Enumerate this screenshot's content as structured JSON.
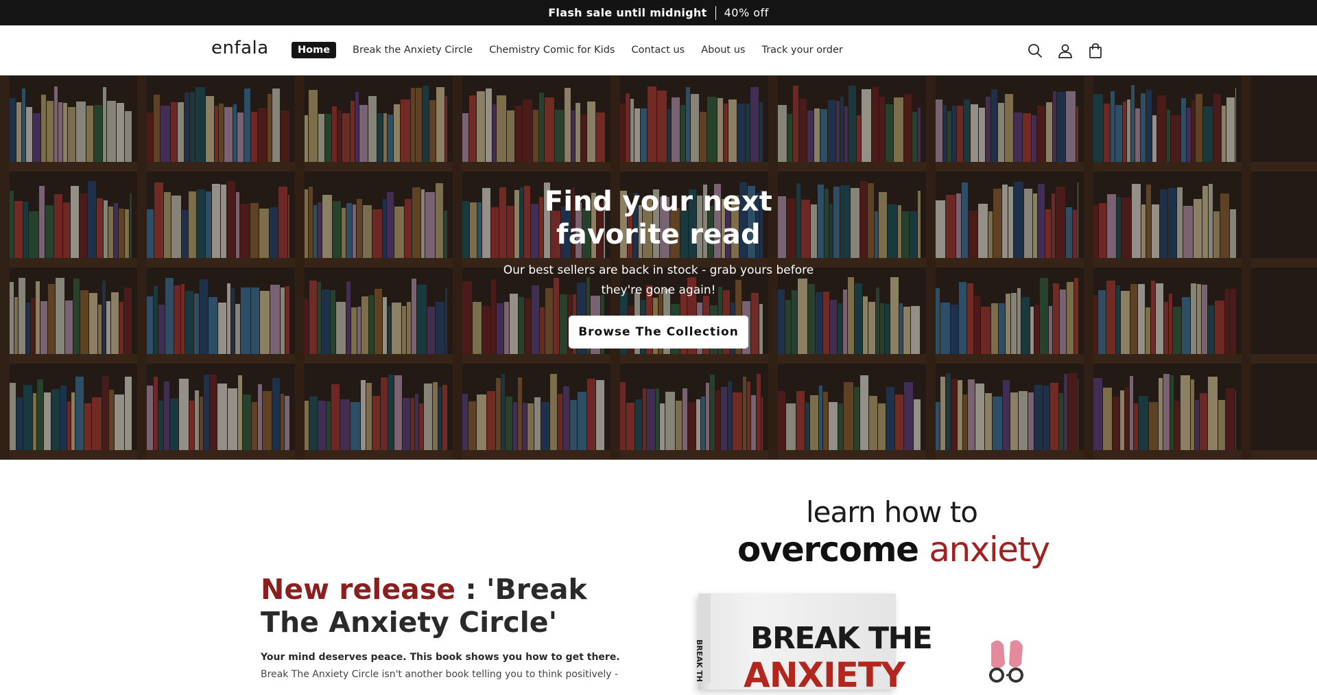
{
  "announcement": {
    "strong": "Flash sale until midnight",
    "light": "40% off"
  },
  "header": {
    "logo": "enfala",
    "nav": [
      {
        "label": "Home",
        "active": true
      },
      {
        "label": "Break the Anxiety Circle",
        "active": false
      },
      {
        "label": "Chemistry Comic for Kids",
        "active": false
      },
      {
        "label": "Contact us",
        "active": false
      },
      {
        "label": "About us",
        "active": false
      },
      {
        "label": "Track your order",
        "active": false
      }
    ],
    "icons": [
      "search-icon",
      "account-icon",
      "cart-icon"
    ]
  },
  "hero": {
    "title": "Find your next favorite read",
    "subtitle": "Our best sellers are back in stock - grab yours before they're gone again!",
    "button": "Browse The Collection"
  },
  "release": {
    "title_accent": "New release",
    "title_rest": " : 'Break The Anxiety Circle'",
    "lead": "Your mind deserves peace. This book shows you how to get there.",
    "body": "Break The Anxiety Circle isn't another book telling you to think positively -",
    "promo_line1": "learn how to",
    "promo_line2a": "overcome ",
    "promo_line2b": "anxiety",
    "book_line1": "BREAK THE",
    "book_line2": "ANXIETY",
    "book_spine": "BREAK TH"
  },
  "colors": {
    "accent": "#8b1e1e",
    "dark": "#141414"
  }
}
